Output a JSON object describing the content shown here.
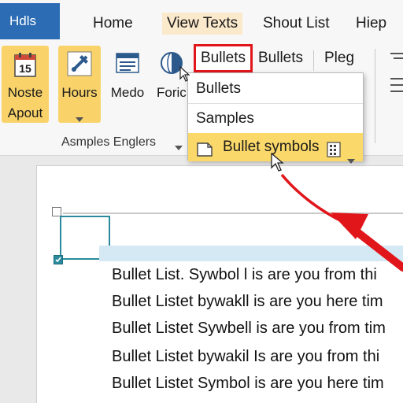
{
  "tabs": {
    "file": "Hdls",
    "home": "Home",
    "view_texts": "View Texts",
    "shout_list": "Shout List",
    "help": "Hiep"
  },
  "ribbon": {
    "noste": {
      "line1": "Noste",
      "line2": "Apout",
      "icon_text": "15"
    },
    "hours": {
      "label": "Hours"
    },
    "medo": {
      "label": "Medo"
    },
    "foric": {
      "label": "Foric"
    },
    "bullets_highlighted": "Bullets",
    "bullets": "Bullets",
    "pleg": "Pleg",
    "group_label": "Asmples Englers"
  },
  "dropdown": {
    "items": [
      "Bullets",
      "Samples",
      "Bullet symbols"
    ]
  },
  "document": {
    "lines": [
      "Bullet List. Sywbol l is are you from thi",
      "Bullet Listet bywakll is are you here tim",
      "Bullet Listet Sywbell is are you from tim",
      "Bullet Listet bywakil Is are you from thi",
      "Bullet Listet Symbol is are you here tim"
    ]
  },
  "colors": {
    "file_tab": "#2b6cb4",
    "accent_yellow": "#f9d36a",
    "highlight_red": "#e0161b",
    "selection_teal": "#2a8a9c",
    "selection_fill": "#d4e9f4"
  }
}
